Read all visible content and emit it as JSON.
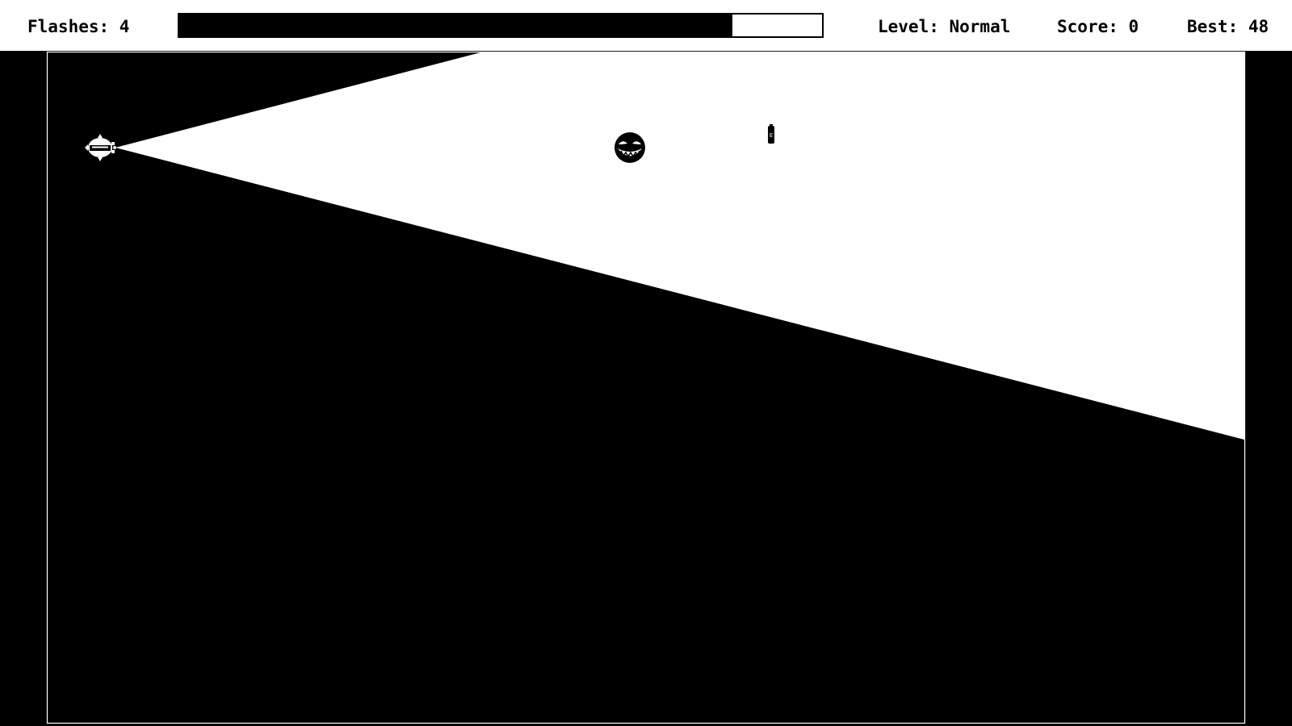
{
  "hud": {
    "flashes_text": "Flashes: 4",
    "level_text": "Level: Normal",
    "score_text": "Score: 0",
    "best_text": "Best: 48",
    "charge_level": 0.86
  },
  "arena": {
    "pickup_label": "E"
  },
  "colors": {
    "background": "#000000",
    "light": "#ffffff"
  },
  "icons": {
    "player": "submarine-light-icon",
    "enemy": "grinning-ghost-face-icon",
    "pickup": "battery-icon"
  }
}
